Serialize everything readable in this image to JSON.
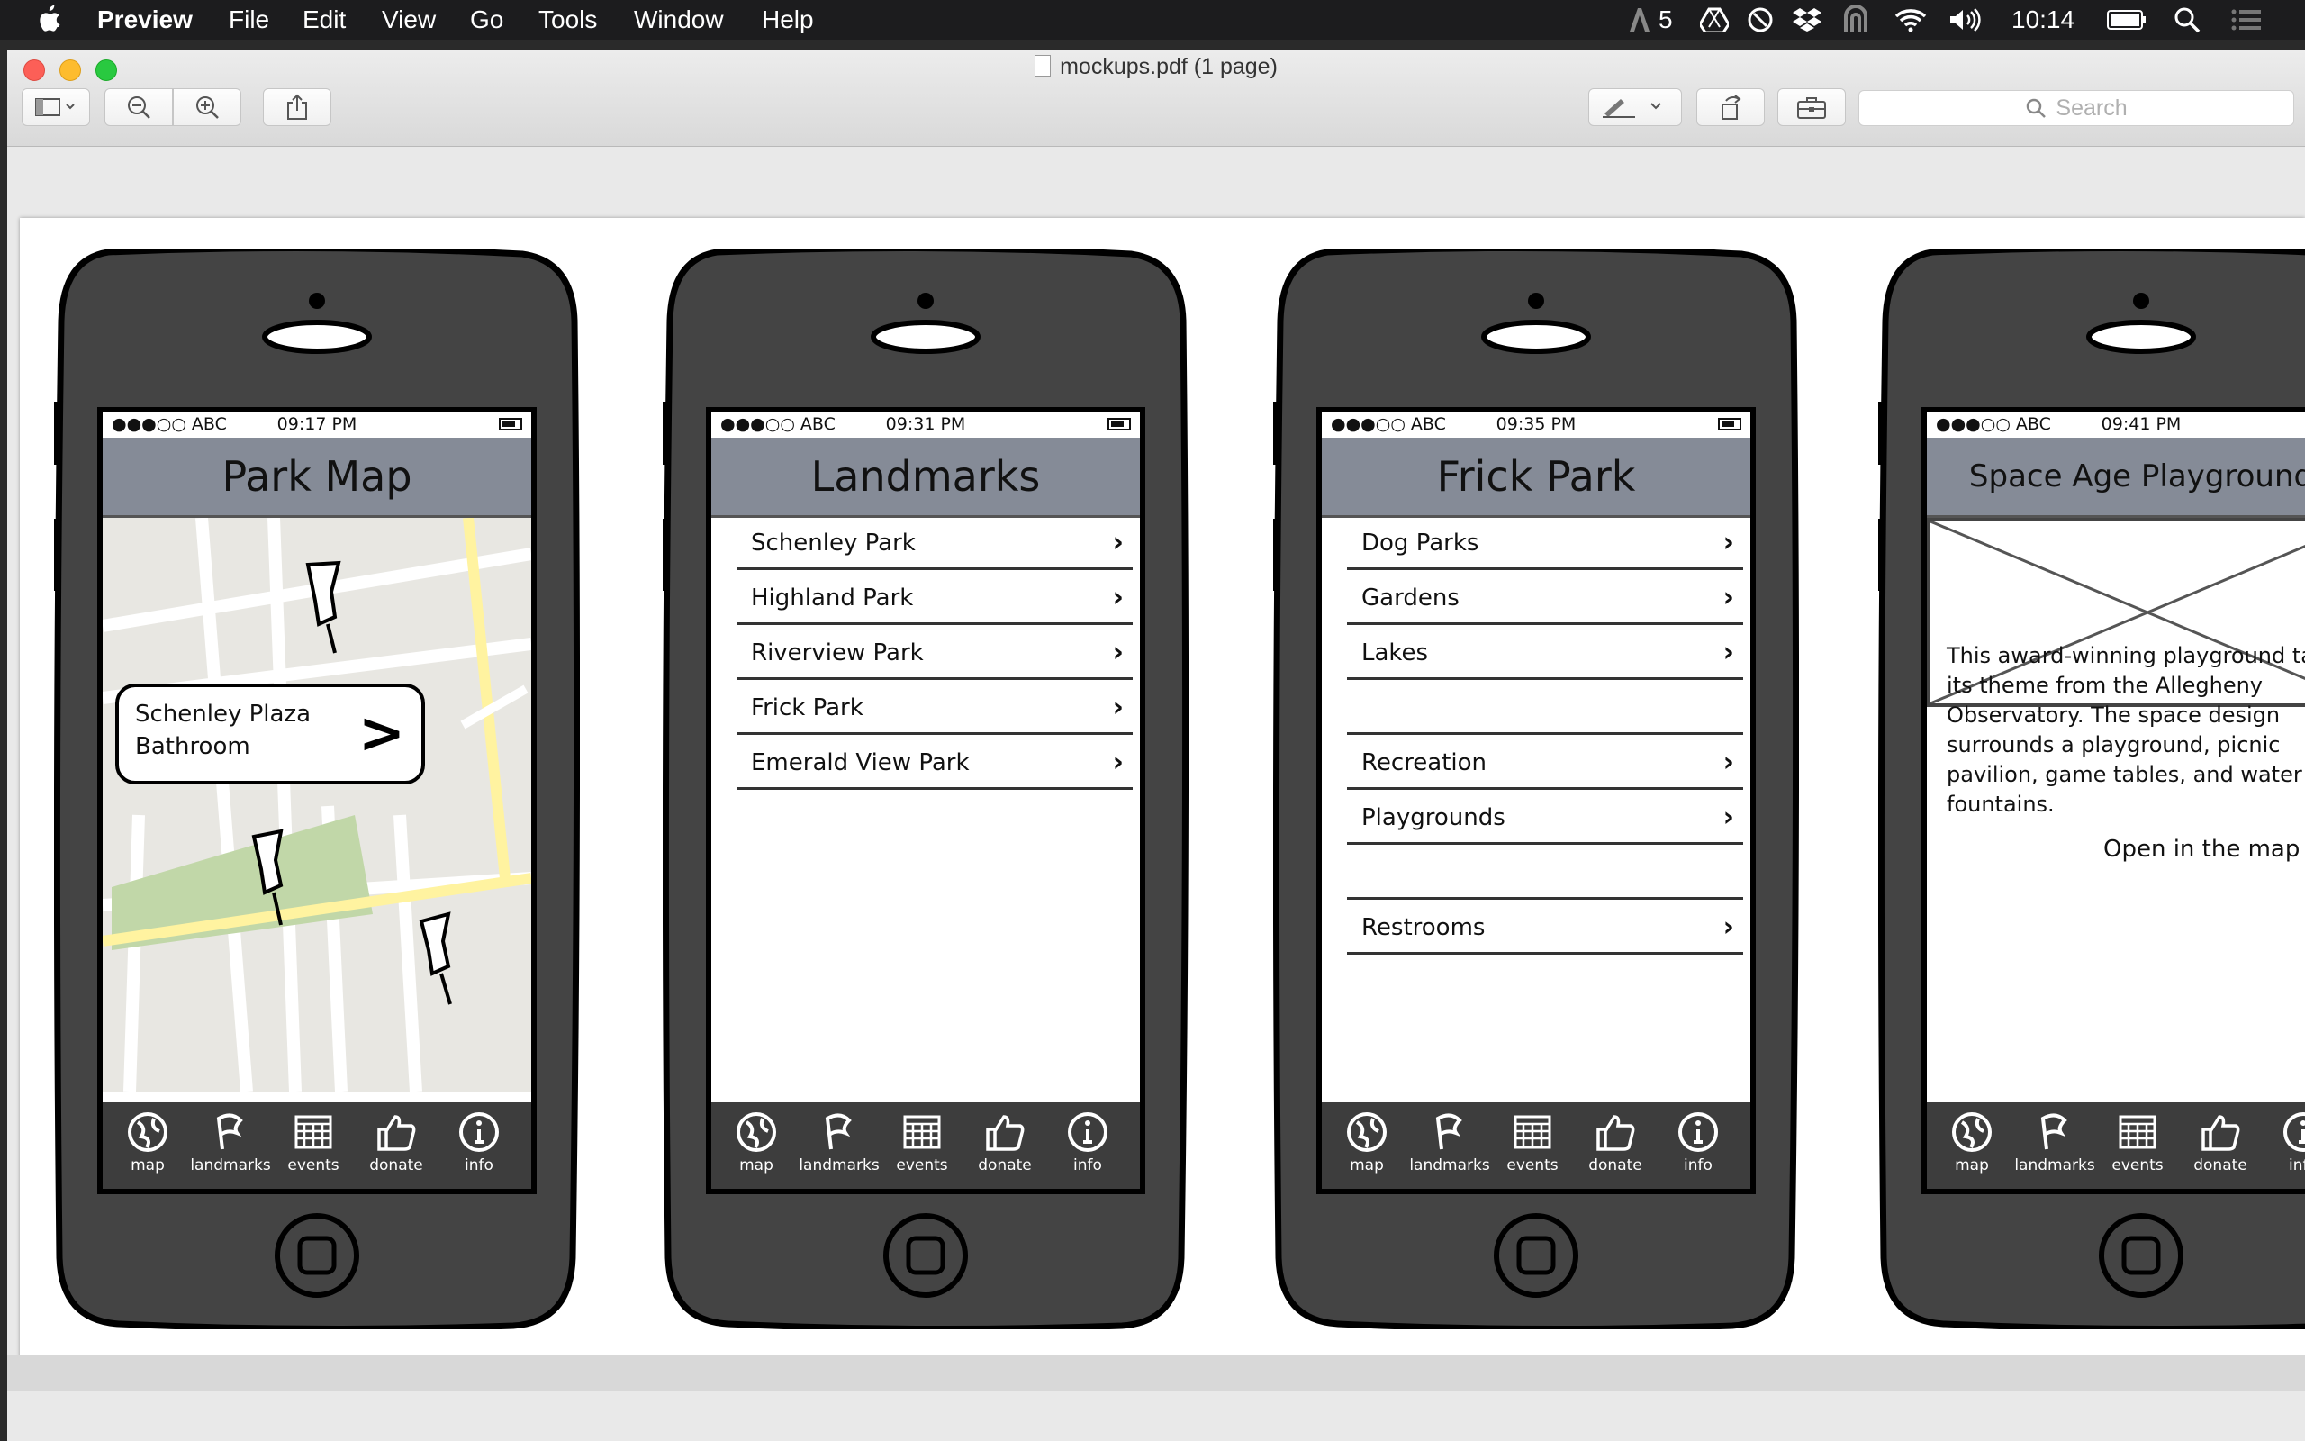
{
  "menubar": {
    "app": "Preview",
    "items": [
      "File",
      "Edit",
      "View",
      "Go",
      "Tools",
      "Window",
      "Help"
    ],
    "adobe_count": "5",
    "clock": "10:14"
  },
  "window": {
    "title": "mockups.pdf (1 page)",
    "search_placeholder": "Search"
  },
  "phones": [
    {
      "status": {
        "carrier": "●●●○○ ABC",
        "time": "09:17 PM"
      },
      "title": "Park Map",
      "callout": {
        "line1": "Schenley Plaza",
        "line2": "Bathroom",
        "chevron": ">"
      }
    },
    {
      "status": {
        "carrier": "●●●○○ ABC",
        "time": "09:31 PM"
      },
      "title": "Landmarks",
      "rows": [
        "Schenley Park",
        "Highland Park",
        "Riverview Park",
        "Frick Park",
        "Emerald View Park"
      ]
    },
    {
      "status": {
        "carrier": "●●●○○ ABC",
        "time": "09:35 PM"
      },
      "title": "Frick Park",
      "rows": [
        "Dog Parks",
        "Gardens",
        "Lakes",
        "",
        "Recreation",
        "Playgrounds",
        "",
        "Restrooms"
      ]
    },
    {
      "status": {
        "carrier": "●●●○○ ABC",
        "time": "09:41 PM"
      },
      "title": "Space Age Playground",
      "description": "This award-winning playground takes its theme from the Allegheny Observatory. The space design surrounds a playground, picnic pavilion, game tables, and water fountains.",
      "open_map": "Open in the map"
    }
  ],
  "tabs": [
    "map",
    "landmarks",
    "events",
    "donate",
    "info"
  ],
  "chevron": "›",
  "colors": {
    "navbar": "#858b97",
    "phone_body": "#444444",
    "map_park": "#c1d7a8",
    "map_road": "#fff3a0"
  }
}
